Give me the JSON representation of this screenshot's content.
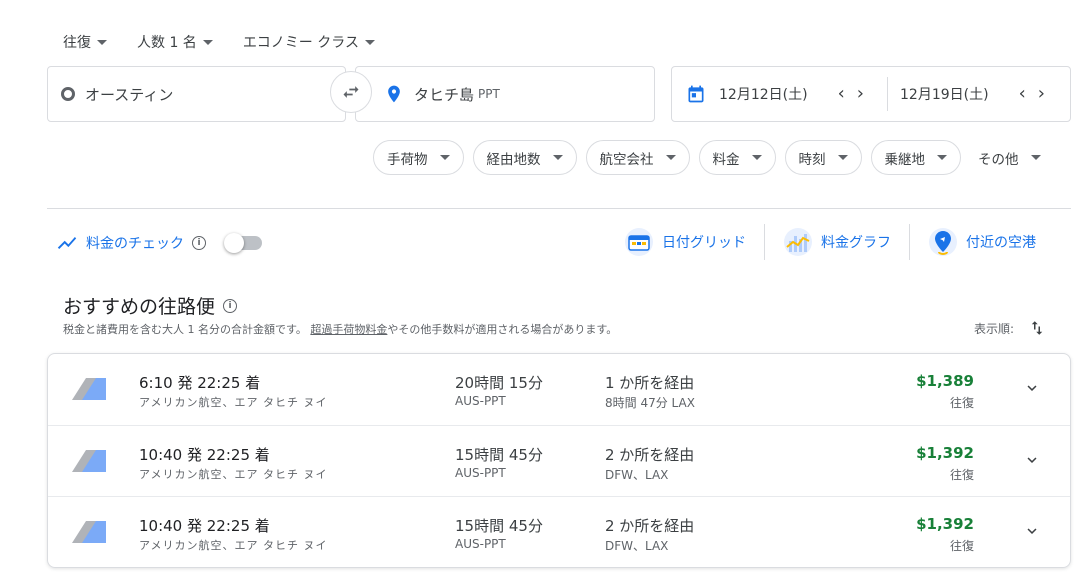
{
  "search": {
    "trip_type": "往復",
    "passengers": "人数 1 名",
    "cabin": "エコノミー クラス",
    "origin": "オースティン",
    "destination": "タヒチ島",
    "destination_code": "PPT",
    "depart_date": "12月12日(土)",
    "return_date": "12月19日(土)"
  },
  "filters": [
    {
      "label": "手荷物"
    },
    {
      "label": "経由地数"
    },
    {
      "label": "航空会社"
    },
    {
      "label": "料金"
    },
    {
      "label": "時刻"
    },
    {
      "label": "乗継地"
    },
    {
      "label": "その他"
    }
  ],
  "tracker": {
    "label": "料金のチェック"
  },
  "tools": {
    "date_grid": "日付グリッド",
    "price_graph": "料金グラフ",
    "nearby": "付近の空港"
  },
  "section": {
    "title": "おすすめの往路便",
    "subtitle_before": "税金と諸費用を含む大人 1 名分の合計金額です。",
    "subtitle_link": "超過手荷物料金",
    "subtitle_after": "やその他手数料が適用される場合があります。",
    "sort_label": "表示順:"
  },
  "flights": [
    {
      "times": "6:10 発 22:25 着",
      "airline": "アメリカン航空、エア タヒチ ヌイ",
      "duration": "20時間 15分",
      "route": "AUS-PPT",
      "stops": "1 か所を経由",
      "via": "8時間 47分 LAX",
      "price": "$1,389",
      "trip": "往復"
    },
    {
      "times": "10:40 発 22:25 着",
      "airline": "アメリカン航空、エア タヒチ ヌイ",
      "duration": "15時間 45分",
      "route": "AUS-PPT",
      "stops": "2 か所を経由",
      "via": "DFW、LAX",
      "price": "$1,392",
      "trip": "往復"
    },
    {
      "times": "10:40 発 22:25 着",
      "airline": "アメリカン航空、エア タヒチ ヌイ",
      "duration": "15時間 45分",
      "route": "AUS-PPT",
      "stops": "2 か所を経由",
      "via": "DFW、LAX",
      "price": "$1,392",
      "trip": "往復"
    }
  ],
  "colors": {
    "accent": "#1a73e8",
    "price": "#188038"
  }
}
